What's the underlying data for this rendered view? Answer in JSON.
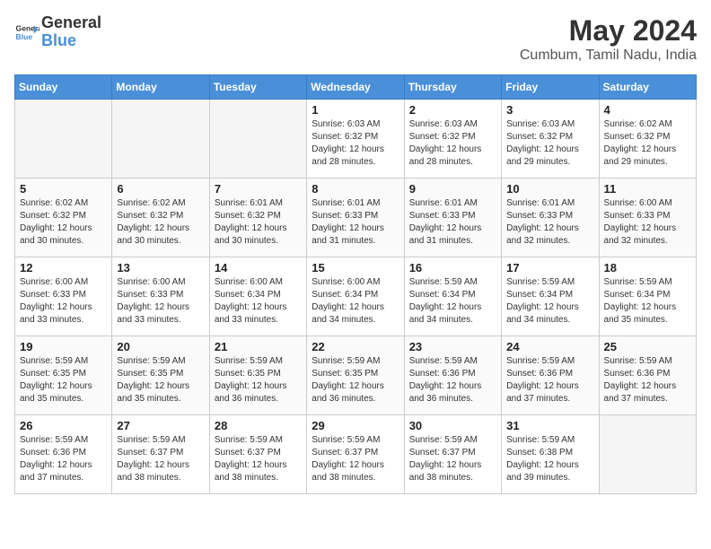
{
  "header": {
    "logo_text_general": "General",
    "logo_text_blue": "Blue",
    "month_year": "May 2024",
    "location": "Cumbum, Tamil Nadu, India"
  },
  "days_of_week": [
    "Sunday",
    "Monday",
    "Tuesday",
    "Wednesday",
    "Thursday",
    "Friday",
    "Saturday"
  ],
  "weeks": [
    [
      {
        "day": "",
        "empty": true
      },
      {
        "day": "",
        "empty": true
      },
      {
        "day": "",
        "empty": true
      },
      {
        "day": "1",
        "sunrise": "6:03 AM",
        "sunset": "6:32 PM",
        "daylight": "12 hours and 28 minutes."
      },
      {
        "day": "2",
        "sunrise": "6:03 AM",
        "sunset": "6:32 PM",
        "daylight": "12 hours and 28 minutes."
      },
      {
        "day": "3",
        "sunrise": "6:03 AM",
        "sunset": "6:32 PM",
        "daylight": "12 hours and 29 minutes."
      },
      {
        "day": "4",
        "sunrise": "6:02 AM",
        "sunset": "6:32 PM",
        "daylight": "12 hours and 29 minutes."
      }
    ],
    [
      {
        "day": "5",
        "sunrise": "6:02 AM",
        "sunset": "6:32 PM",
        "daylight": "12 hours and 30 minutes."
      },
      {
        "day": "6",
        "sunrise": "6:02 AM",
        "sunset": "6:32 PM",
        "daylight": "12 hours and 30 minutes."
      },
      {
        "day": "7",
        "sunrise": "6:01 AM",
        "sunset": "6:32 PM",
        "daylight": "12 hours and 30 minutes."
      },
      {
        "day": "8",
        "sunrise": "6:01 AM",
        "sunset": "6:33 PM",
        "daylight": "12 hours and 31 minutes."
      },
      {
        "day": "9",
        "sunrise": "6:01 AM",
        "sunset": "6:33 PM",
        "daylight": "12 hours and 31 minutes."
      },
      {
        "day": "10",
        "sunrise": "6:01 AM",
        "sunset": "6:33 PM",
        "daylight": "12 hours and 32 minutes."
      },
      {
        "day": "11",
        "sunrise": "6:00 AM",
        "sunset": "6:33 PM",
        "daylight": "12 hours and 32 minutes."
      }
    ],
    [
      {
        "day": "12",
        "sunrise": "6:00 AM",
        "sunset": "6:33 PM",
        "daylight": "12 hours and 33 minutes."
      },
      {
        "day": "13",
        "sunrise": "6:00 AM",
        "sunset": "6:33 PM",
        "daylight": "12 hours and 33 minutes."
      },
      {
        "day": "14",
        "sunrise": "6:00 AM",
        "sunset": "6:34 PM",
        "daylight": "12 hours and 33 minutes."
      },
      {
        "day": "15",
        "sunrise": "6:00 AM",
        "sunset": "6:34 PM",
        "daylight": "12 hours and 34 minutes."
      },
      {
        "day": "16",
        "sunrise": "5:59 AM",
        "sunset": "6:34 PM",
        "daylight": "12 hours and 34 minutes."
      },
      {
        "day": "17",
        "sunrise": "5:59 AM",
        "sunset": "6:34 PM",
        "daylight": "12 hours and 34 minutes."
      },
      {
        "day": "18",
        "sunrise": "5:59 AM",
        "sunset": "6:34 PM",
        "daylight": "12 hours and 35 minutes."
      }
    ],
    [
      {
        "day": "19",
        "sunrise": "5:59 AM",
        "sunset": "6:35 PM",
        "daylight": "12 hours and 35 minutes."
      },
      {
        "day": "20",
        "sunrise": "5:59 AM",
        "sunset": "6:35 PM",
        "daylight": "12 hours and 35 minutes."
      },
      {
        "day": "21",
        "sunrise": "5:59 AM",
        "sunset": "6:35 PM",
        "daylight": "12 hours and 36 minutes."
      },
      {
        "day": "22",
        "sunrise": "5:59 AM",
        "sunset": "6:35 PM",
        "daylight": "12 hours and 36 minutes."
      },
      {
        "day": "23",
        "sunrise": "5:59 AM",
        "sunset": "6:36 PM",
        "daylight": "12 hours and 36 minutes."
      },
      {
        "day": "24",
        "sunrise": "5:59 AM",
        "sunset": "6:36 PM",
        "daylight": "12 hours and 37 minutes."
      },
      {
        "day": "25",
        "sunrise": "5:59 AM",
        "sunset": "6:36 PM",
        "daylight": "12 hours and 37 minutes."
      }
    ],
    [
      {
        "day": "26",
        "sunrise": "5:59 AM",
        "sunset": "6:36 PM",
        "daylight": "12 hours and 37 minutes."
      },
      {
        "day": "27",
        "sunrise": "5:59 AM",
        "sunset": "6:37 PM",
        "daylight": "12 hours and 38 minutes."
      },
      {
        "day": "28",
        "sunrise": "5:59 AM",
        "sunset": "6:37 PM",
        "daylight": "12 hours and 38 minutes."
      },
      {
        "day": "29",
        "sunrise": "5:59 AM",
        "sunset": "6:37 PM",
        "daylight": "12 hours and 38 minutes."
      },
      {
        "day": "30",
        "sunrise": "5:59 AM",
        "sunset": "6:37 PM",
        "daylight": "12 hours and 38 minutes."
      },
      {
        "day": "31",
        "sunrise": "5:59 AM",
        "sunset": "6:38 PM",
        "daylight": "12 hours and 39 minutes."
      },
      {
        "day": "",
        "empty": true
      }
    ]
  ]
}
